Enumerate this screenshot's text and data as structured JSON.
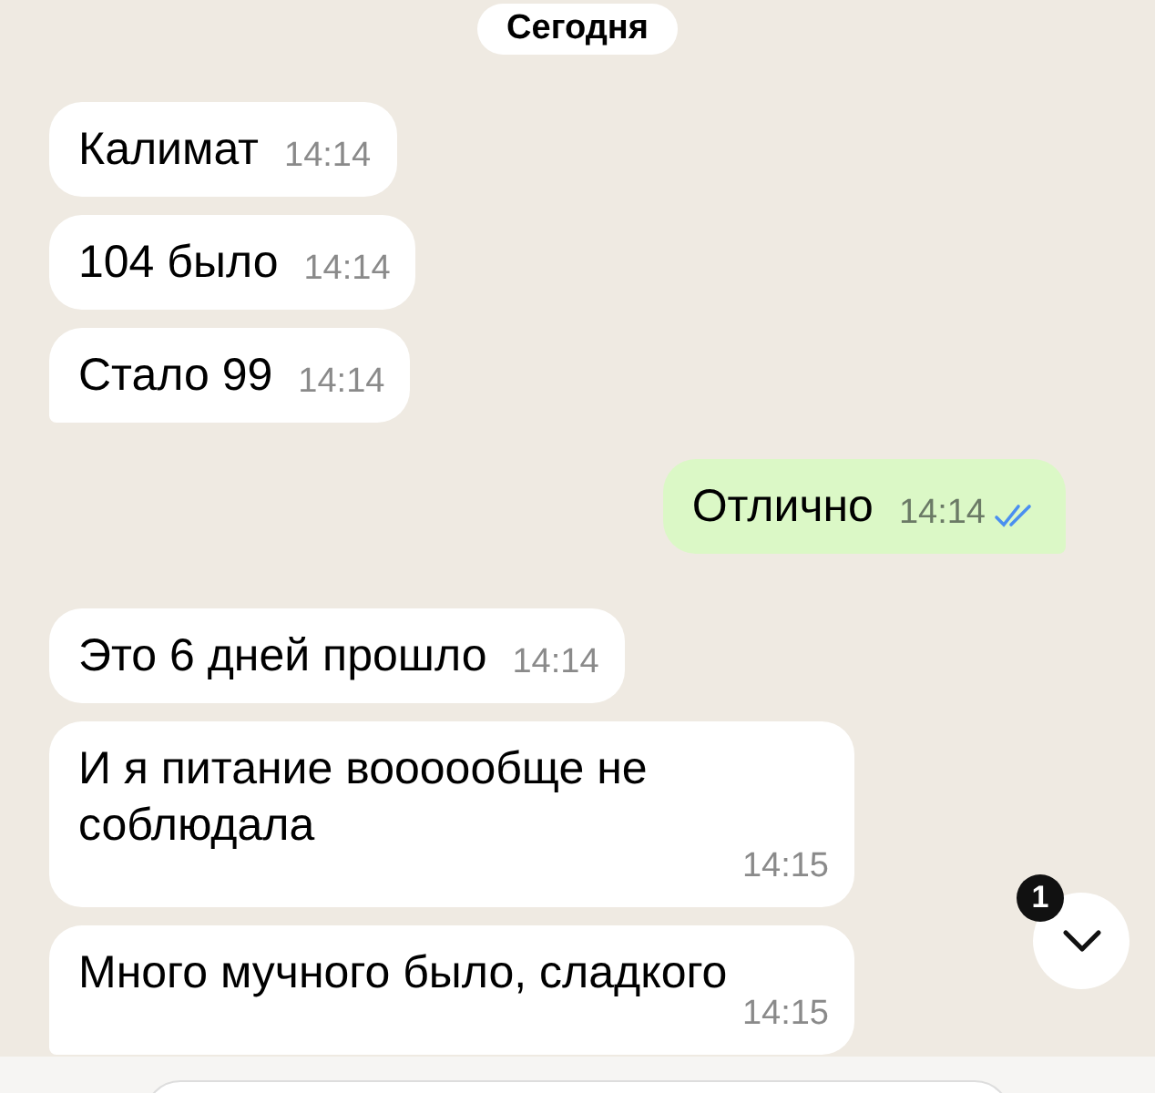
{
  "date_divider": "Сегодня",
  "messages": [
    {
      "outgoing": false,
      "text": "Калимат",
      "time": "14:14",
      "tail": false
    },
    {
      "outgoing": false,
      "text": "104 было",
      "time": "14:14",
      "tail": false
    },
    {
      "outgoing": false,
      "text": "Стало 99",
      "time": "14:14",
      "tail": true
    },
    {
      "outgoing": true,
      "text": "Отлично",
      "time": "14:14",
      "tail": true,
      "read": true
    },
    {
      "outgoing": false,
      "text": "Это 6 дней прошло",
      "time": "14:14",
      "tail": false
    },
    {
      "outgoing": false,
      "text": "И я питание воооообще не соблюдала",
      "time": "14:15",
      "tail": false
    },
    {
      "outgoing": false,
      "text": "Много мучного было, сладкого",
      "time": "14:15",
      "tail": true
    }
  ],
  "scroll_button": {
    "unread_count": "1"
  }
}
